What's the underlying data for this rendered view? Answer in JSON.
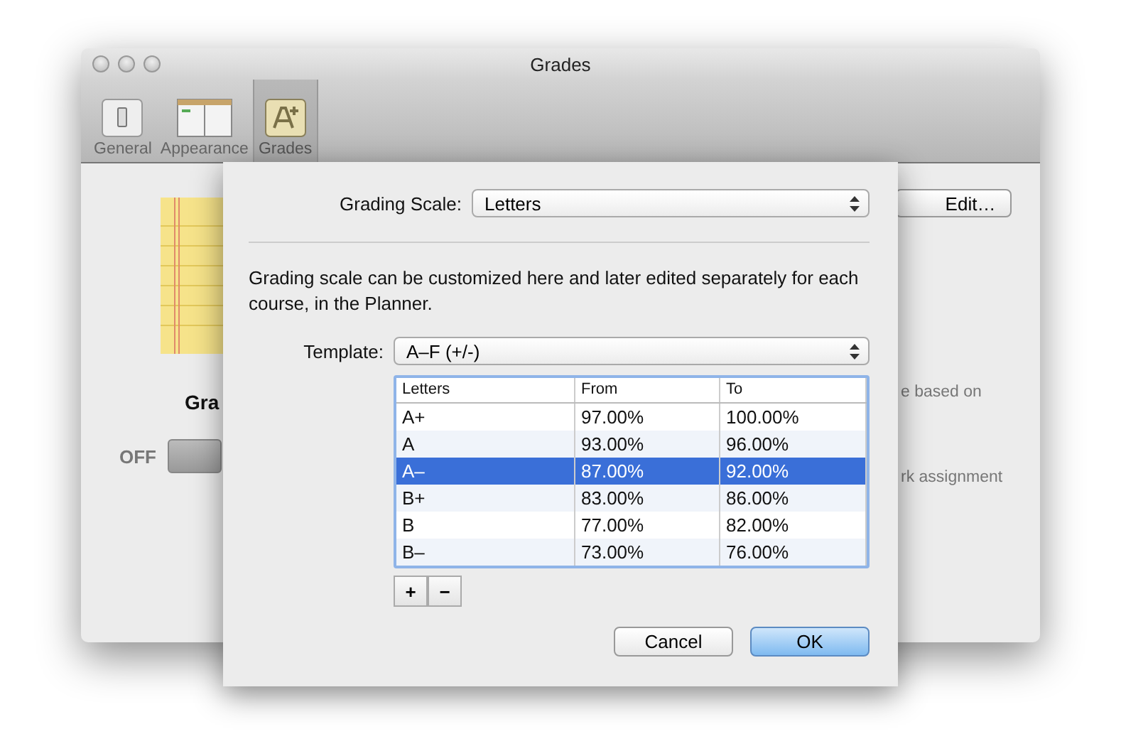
{
  "window": {
    "title": "Grades"
  },
  "toolbar": [
    {
      "label": "General",
      "kind": "general",
      "selected": false
    },
    {
      "label": "Appearance",
      "kind": "appearance",
      "selected": false
    },
    {
      "label": "Grades",
      "kind": "grades",
      "selected": true
    }
  ],
  "background": {
    "heading": "Gra",
    "toggle_label": "OFF",
    "toggle_on": false,
    "edit_button": "Edit…",
    "text_1": "e based on",
    "text_2": "rk assignment"
  },
  "sheet": {
    "scale_label": "Grading Scale:",
    "scale_value": "Letters",
    "description": "Grading scale can be customized here and later edited separately for each course, in the Planner.",
    "template_label": "Template:",
    "template_value": "A–F (+/-)",
    "table": {
      "columns": [
        "Letters",
        "From",
        "To"
      ],
      "rows": [
        {
          "cells": [
            "A+",
            "97.00%",
            "100.00%"
          ],
          "selected": false
        },
        {
          "cells": [
            "A",
            "93.00%",
            "96.00%"
          ],
          "selected": false
        },
        {
          "cells": [
            "A–",
            "87.00%",
            "92.00%"
          ],
          "selected": true
        },
        {
          "cells": [
            "B+",
            "83.00%",
            "86.00%"
          ],
          "selected": false
        },
        {
          "cells": [
            "B",
            "77.00%",
            "82.00%"
          ],
          "selected": false
        },
        {
          "cells": [
            "B–",
            "73.00%",
            "76.00%"
          ],
          "selected": false
        }
      ]
    },
    "add_button": "+",
    "remove_button": "−",
    "buttons": [
      {
        "label": "Cancel",
        "kind": "normal"
      },
      {
        "label": "OK",
        "kind": "default"
      }
    ]
  }
}
